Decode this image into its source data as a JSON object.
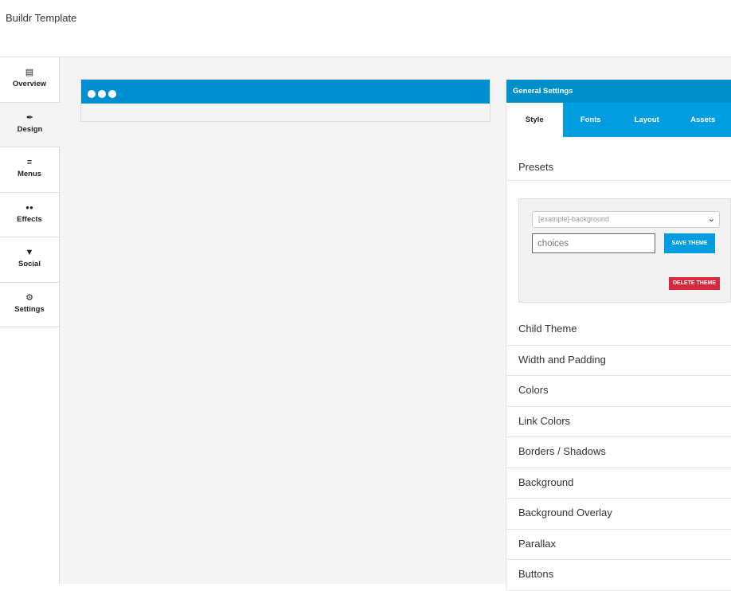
{
  "app": {
    "title": "Buildr Template"
  },
  "sidebar": {
    "items": [
      {
        "label": "Overview",
        "icon": "book-icon",
        "glyph": "📖"
      },
      {
        "label": "Design",
        "icon": "feather-icon",
        "glyph": "✒"
      },
      {
        "label": "Menus",
        "icon": "menu-icon",
        "glyph": "≡"
      },
      {
        "label": "Effects",
        "icon": "drops-icon",
        "glyph": "💧"
      },
      {
        "label": "Social",
        "icon": "twitter-icon",
        "glyph": "🐦"
      },
      {
        "label": "Settings",
        "icon": "gear-icon",
        "glyph": "⚙"
      }
    ]
  },
  "panel": {
    "title": "General Settings",
    "tabs": [
      "Style",
      "Fonts",
      "Layout",
      "Assets"
    ],
    "presets": {
      "title": "Presets",
      "select_value": "[example]-background",
      "input_placeholder": "choices",
      "save_label": "SAVE THEME",
      "delete_label": "DELETE THEME"
    },
    "sections": [
      "Child Theme",
      "Width and Padding",
      "Colors",
      "Link Colors",
      "Borders / Shadows",
      "Background",
      "Background Overlay",
      "Parallax",
      "Buttons"
    ]
  },
  "colors": {
    "primary": "#009ee0",
    "header": "#008fca",
    "danger": "#d8283e"
  }
}
